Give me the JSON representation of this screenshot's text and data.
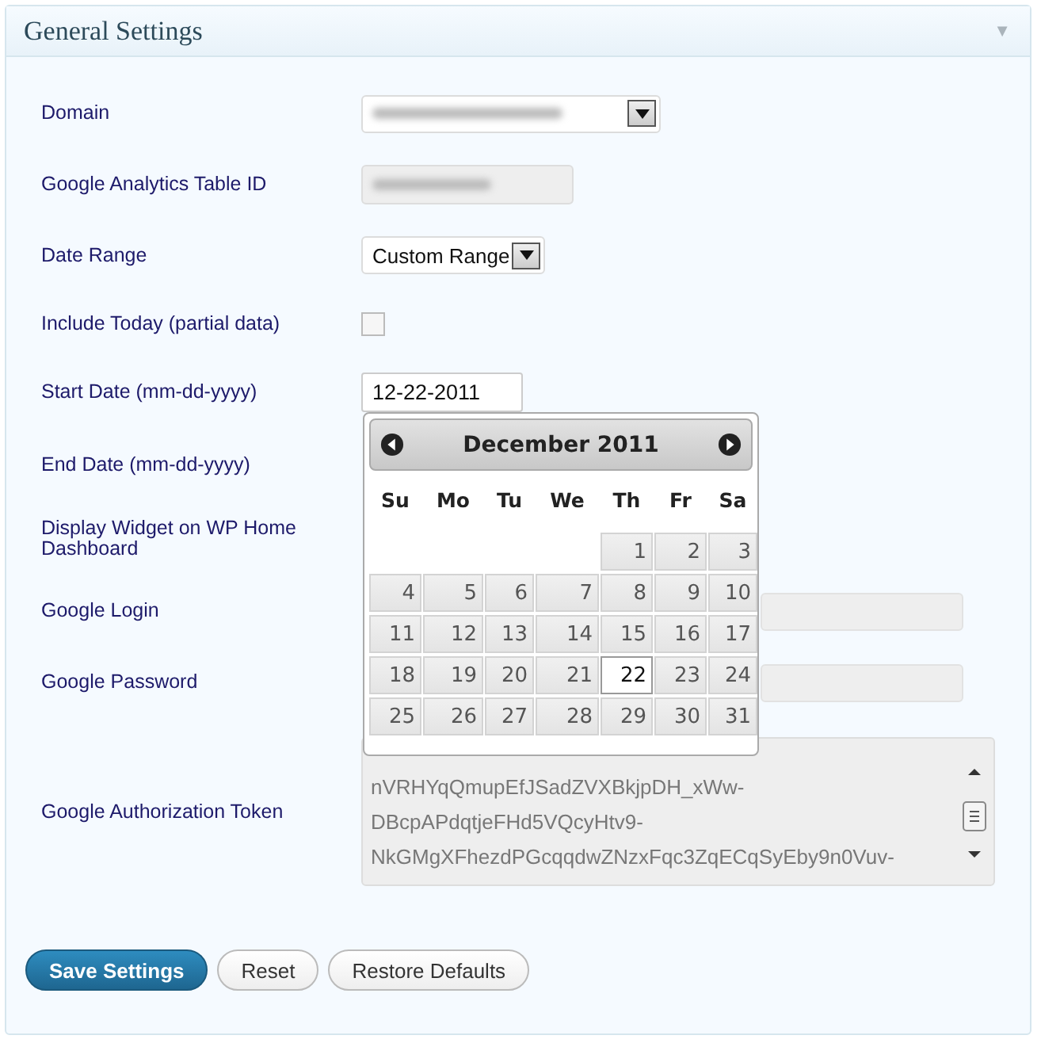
{
  "panel": {
    "title": "General Settings",
    "collapse_icon": "▼"
  },
  "fields": [
    {
      "label": "Domain",
      "kind": "select",
      "blurred": true
    },
    {
      "label": "Google Analytics Table ID",
      "kind": "disabled_text",
      "blurred": true
    },
    {
      "label": "Date Range",
      "kind": "select",
      "value": "Custom Range"
    },
    {
      "label": "Include Today (partial data)",
      "kind": "checkbox",
      "checked": false
    },
    {
      "label": "Start Date (mm-dd-yyyy)",
      "kind": "date",
      "value": "12-22-2011"
    },
    {
      "label": "End Date (mm-dd-yyyy)",
      "kind": "covered"
    },
    {
      "label": "Display Widget on WP Home Dashboard",
      "kind": "covered"
    },
    {
      "label": "Google Login",
      "kind": "text"
    },
    {
      "label": "Google Password",
      "kind": "text"
    },
    {
      "label": "Google Authorization Token",
      "kind": "textarea",
      "lines": [
        "nVRHYqQmupEfJSadZVXBkjpDH_xWw-",
        "DBcpAPdqtjeFHd5VQcyHtv9-",
        "NkGMgXFhezdPGcqqdwZNzxFqc3ZqECqSyEby9n0Vuv-"
      ]
    }
  ],
  "calendar": {
    "title": "December 2011",
    "weekdays": [
      "Su",
      "Mo",
      "Tu",
      "We",
      "Th",
      "Fr",
      "Sa"
    ],
    "weeks": [
      [
        {
          "kind": "blank"
        },
        {
          "kind": "blank"
        },
        {
          "kind": "blank"
        },
        {
          "kind": "blank"
        },
        {
          "day": "1",
          "selected": false
        },
        {
          "day": "2",
          "selected": false
        },
        {
          "day": "3",
          "selected": false
        }
      ],
      [
        {
          "day": "4",
          "selected": false
        },
        {
          "day": "5",
          "selected": false
        },
        {
          "day": "6",
          "selected": false
        },
        {
          "day": "7",
          "selected": false
        },
        {
          "day": "8",
          "selected": false
        },
        {
          "day": "9",
          "selected": false
        },
        {
          "day": "10",
          "selected": false
        }
      ],
      [
        {
          "day": "11",
          "selected": false
        },
        {
          "day": "12",
          "selected": false
        },
        {
          "day": "13",
          "selected": false
        },
        {
          "day": "14",
          "selected": false
        },
        {
          "day": "15",
          "selected": false
        },
        {
          "day": "16",
          "selected": false
        },
        {
          "day": "17",
          "selected": false
        }
      ],
      [
        {
          "day": "18",
          "selected": false
        },
        {
          "day": "19",
          "selected": false
        },
        {
          "day": "20",
          "selected": false
        },
        {
          "day": "21",
          "selected": false
        },
        {
          "day": "22",
          "selected": true
        },
        {
          "day": "23",
          "selected": false
        },
        {
          "day": "24",
          "selected": false
        }
      ],
      [
        {
          "day": "25",
          "selected": false
        },
        {
          "day": "26",
          "selected": false
        },
        {
          "day": "27",
          "selected": false
        },
        {
          "day": "28",
          "selected": false
        },
        {
          "day": "29",
          "selected": false
        },
        {
          "day": "30",
          "selected": false
        },
        {
          "day": "31",
          "selected": false
        }
      ]
    ]
  },
  "buttons": [
    {
      "label": "Save Settings",
      "primary": true
    },
    {
      "label": "Reset",
      "primary": false
    },
    {
      "label": "Restore Defaults",
      "primary": false
    }
  ]
}
